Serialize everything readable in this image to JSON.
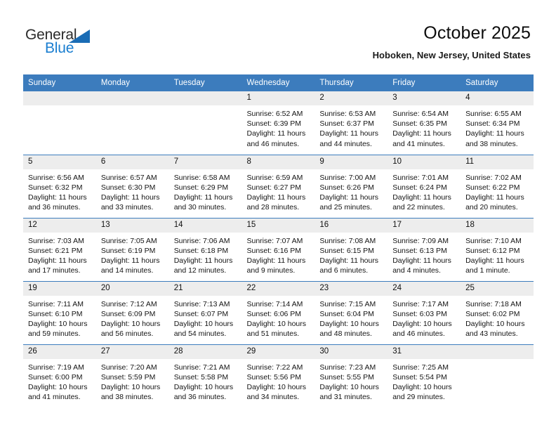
{
  "brand": {
    "name_part1": "General",
    "name_part2": "Blue",
    "logo_icon": "triangle-flag-icon",
    "color_dark": "#2b2b2b",
    "color_blue": "#1a7ed0"
  },
  "header": {
    "title": "October 2025",
    "location": "Hoboken, New Jersey, United States"
  },
  "theme": {
    "header_blue": "#3c7cbd",
    "daynum_band": "#ededed",
    "text": "#141414"
  },
  "calendar": {
    "weekday_headers": [
      "Sunday",
      "Monday",
      "Tuesday",
      "Wednesday",
      "Thursday",
      "Friday",
      "Saturday"
    ],
    "weeks": [
      [
        {
          "day": "",
          "blank": true,
          "lines": []
        },
        {
          "day": "",
          "blank": true,
          "lines": []
        },
        {
          "day": "",
          "blank": true,
          "lines": []
        },
        {
          "day": "1",
          "blank": false,
          "lines": [
            "Sunrise: 6:52 AM",
            "Sunset: 6:39 PM",
            "Daylight: 11 hours",
            "and 46 minutes."
          ]
        },
        {
          "day": "2",
          "blank": false,
          "lines": [
            "Sunrise: 6:53 AM",
            "Sunset: 6:37 PM",
            "Daylight: 11 hours",
            "and 44 minutes."
          ]
        },
        {
          "day": "3",
          "blank": false,
          "lines": [
            "Sunrise: 6:54 AM",
            "Sunset: 6:35 PM",
            "Daylight: 11 hours",
            "and 41 minutes."
          ]
        },
        {
          "day": "4",
          "blank": false,
          "lines": [
            "Sunrise: 6:55 AM",
            "Sunset: 6:34 PM",
            "Daylight: 11 hours",
            "and 38 minutes."
          ]
        }
      ],
      [
        {
          "day": "5",
          "blank": false,
          "lines": [
            "Sunrise: 6:56 AM",
            "Sunset: 6:32 PM",
            "Daylight: 11 hours",
            "and 36 minutes."
          ]
        },
        {
          "day": "6",
          "blank": false,
          "lines": [
            "Sunrise: 6:57 AM",
            "Sunset: 6:30 PM",
            "Daylight: 11 hours",
            "and 33 minutes."
          ]
        },
        {
          "day": "7",
          "blank": false,
          "lines": [
            "Sunrise: 6:58 AM",
            "Sunset: 6:29 PM",
            "Daylight: 11 hours",
            "and 30 minutes."
          ]
        },
        {
          "day": "8",
          "blank": false,
          "lines": [
            "Sunrise: 6:59 AM",
            "Sunset: 6:27 PM",
            "Daylight: 11 hours",
            "and 28 minutes."
          ]
        },
        {
          "day": "9",
          "blank": false,
          "lines": [
            "Sunrise: 7:00 AM",
            "Sunset: 6:26 PM",
            "Daylight: 11 hours",
            "and 25 minutes."
          ]
        },
        {
          "day": "10",
          "blank": false,
          "lines": [
            "Sunrise: 7:01 AM",
            "Sunset: 6:24 PM",
            "Daylight: 11 hours",
            "and 22 minutes."
          ]
        },
        {
          "day": "11",
          "blank": false,
          "lines": [
            "Sunrise: 7:02 AM",
            "Sunset: 6:22 PM",
            "Daylight: 11 hours",
            "and 20 minutes."
          ]
        }
      ],
      [
        {
          "day": "12",
          "blank": false,
          "lines": [
            "Sunrise: 7:03 AM",
            "Sunset: 6:21 PM",
            "Daylight: 11 hours",
            "and 17 minutes."
          ]
        },
        {
          "day": "13",
          "blank": false,
          "lines": [
            "Sunrise: 7:05 AM",
            "Sunset: 6:19 PM",
            "Daylight: 11 hours",
            "and 14 minutes."
          ]
        },
        {
          "day": "14",
          "blank": false,
          "lines": [
            "Sunrise: 7:06 AM",
            "Sunset: 6:18 PM",
            "Daylight: 11 hours",
            "and 12 minutes."
          ]
        },
        {
          "day": "15",
          "blank": false,
          "lines": [
            "Sunrise: 7:07 AM",
            "Sunset: 6:16 PM",
            "Daylight: 11 hours",
            "and 9 minutes."
          ]
        },
        {
          "day": "16",
          "blank": false,
          "lines": [
            "Sunrise: 7:08 AM",
            "Sunset: 6:15 PM",
            "Daylight: 11 hours",
            "and 6 minutes."
          ]
        },
        {
          "day": "17",
          "blank": false,
          "lines": [
            "Sunrise: 7:09 AM",
            "Sunset: 6:13 PM",
            "Daylight: 11 hours",
            "and 4 minutes."
          ]
        },
        {
          "day": "18",
          "blank": false,
          "lines": [
            "Sunrise: 7:10 AM",
            "Sunset: 6:12 PM",
            "Daylight: 11 hours",
            "and 1 minute."
          ]
        }
      ],
      [
        {
          "day": "19",
          "blank": false,
          "lines": [
            "Sunrise: 7:11 AM",
            "Sunset: 6:10 PM",
            "Daylight: 10 hours",
            "and 59 minutes."
          ]
        },
        {
          "day": "20",
          "blank": false,
          "lines": [
            "Sunrise: 7:12 AM",
            "Sunset: 6:09 PM",
            "Daylight: 10 hours",
            "and 56 minutes."
          ]
        },
        {
          "day": "21",
          "blank": false,
          "lines": [
            "Sunrise: 7:13 AM",
            "Sunset: 6:07 PM",
            "Daylight: 10 hours",
            "and 54 minutes."
          ]
        },
        {
          "day": "22",
          "blank": false,
          "lines": [
            "Sunrise: 7:14 AM",
            "Sunset: 6:06 PM",
            "Daylight: 10 hours",
            "and 51 minutes."
          ]
        },
        {
          "day": "23",
          "blank": false,
          "lines": [
            "Sunrise: 7:15 AM",
            "Sunset: 6:04 PM",
            "Daylight: 10 hours",
            "and 48 minutes."
          ]
        },
        {
          "day": "24",
          "blank": false,
          "lines": [
            "Sunrise: 7:17 AM",
            "Sunset: 6:03 PM",
            "Daylight: 10 hours",
            "and 46 minutes."
          ]
        },
        {
          "day": "25",
          "blank": false,
          "lines": [
            "Sunrise: 7:18 AM",
            "Sunset: 6:02 PM",
            "Daylight: 10 hours",
            "and 43 minutes."
          ]
        }
      ],
      [
        {
          "day": "26",
          "blank": false,
          "lines": [
            "Sunrise: 7:19 AM",
            "Sunset: 6:00 PM",
            "Daylight: 10 hours",
            "and 41 minutes."
          ]
        },
        {
          "day": "27",
          "blank": false,
          "lines": [
            "Sunrise: 7:20 AM",
            "Sunset: 5:59 PM",
            "Daylight: 10 hours",
            "and 38 minutes."
          ]
        },
        {
          "day": "28",
          "blank": false,
          "lines": [
            "Sunrise: 7:21 AM",
            "Sunset: 5:58 PM",
            "Daylight: 10 hours",
            "and 36 minutes."
          ]
        },
        {
          "day": "29",
          "blank": false,
          "lines": [
            "Sunrise: 7:22 AM",
            "Sunset: 5:56 PM",
            "Daylight: 10 hours",
            "and 34 minutes."
          ]
        },
        {
          "day": "30",
          "blank": false,
          "lines": [
            "Sunrise: 7:23 AM",
            "Sunset: 5:55 PM",
            "Daylight: 10 hours",
            "and 31 minutes."
          ]
        },
        {
          "day": "31",
          "blank": false,
          "lines": [
            "Sunrise: 7:25 AM",
            "Sunset: 5:54 PM",
            "Daylight: 10 hours",
            "and 29 minutes."
          ]
        },
        {
          "day": "",
          "blank": true,
          "lines": []
        }
      ]
    ]
  }
}
